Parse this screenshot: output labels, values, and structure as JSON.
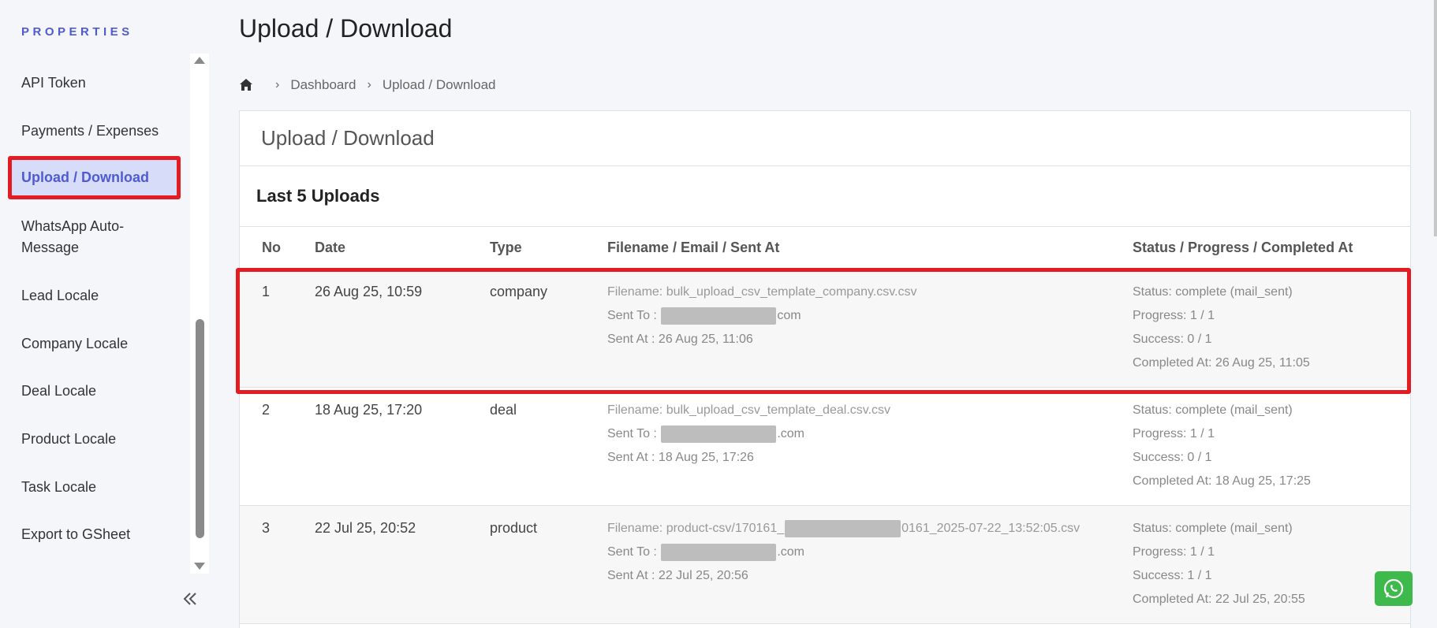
{
  "sidebar": {
    "heading": "PROPERTIES",
    "items": [
      {
        "label": "API Token"
      },
      {
        "label": "Payments / Expenses"
      },
      {
        "label": "Upload / Download",
        "active": true
      },
      {
        "label": "WhatsApp Auto-Message"
      },
      {
        "label": "Lead Locale"
      },
      {
        "label": "Company Locale"
      },
      {
        "label": "Deal Locale"
      },
      {
        "label": "Product Locale"
      },
      {
        "label": "Task Locale"
      },
      {
        "label": "Export to GSheet"
      }
    ],
    "collapse_icon": "double-chevron-left-icon"
  },
  "page": {
    "title": "Upload / Download",
    "breadcrumb": [
      "Dashboard",
      "Upload / Download"
    ]
  },
  "card": {
    "title": "Upload / Download",
    "section_title": "Last 5 Uploads",
    "columns": [
      "No",
      "Date",
      "Type",
      "Filename / Email / Sent At",
      "Status / Progress / Completed At"
    ],
    "rows": [
      {
        "no": "1",
        "date": "26 Aug 25, 10:59",
        "type": "company",
        "filename": "Filename: bulk_upload_csv_template_company.csv.csv",
        "sent_to_prefix": "Sent To :",
        "sent_to_suffix": "com",
        "sent_at": "Sent At : 26 Aug 25, 11:06",
        "status": "Status: complete (mail_sent)",
        "progress": "Progress: 1 / 1",
        "success": "Success: 0 / 1",
        "completed_at": "Completed At: 26 Aug 25, 11:05"
      },
      {
        "no": "2",
        "date": "18 Aug 25, 17:20",
        "type": "deal",
        "filename": "Filename: bulk_upload_csv_template_deal.csv.csv",
        "sent_to_prefix": "Sent To :",
        "sent_to_suffix": ".com",
        "sent_at": "Sent At : 18 Aug 25, 17:26",
        "status": "Status: complete (mail_sent)",
        "progress": "Progress: 1 / 1",
        "success": "Success: 0 / 1",
        "completed_at": "Completed At: 18 Aug 25, 17:25"
      },
      {
        "no": "3",
        "date": "22 Jul 25, 20:52",
        "type": "product",
        "filename_prefix": "Filename: product-csv/170161_",
        "filename_suffix": "0161_2025-07-22_13:52:05.csv",
        "sent_to_prefix": "Sent To :",
        "sent_to_suffix": ".com",
        "sent_at": "Sent At : 22 Jul 25, 20:56",
        "status": "Status: complete (mail_sent)",
        "progress": "Progress: 1 / 1",
        "success": "Success: 1 / 1",
        "completed_at": "Completed At: 22 Jul 25, 20:55"
      }
    ]
  },
  "colors": {
    "accent": "#4f5bd5",
    "highlight": "#e31b23",
    "whatsapp": "#3eb94c"
  }
}
